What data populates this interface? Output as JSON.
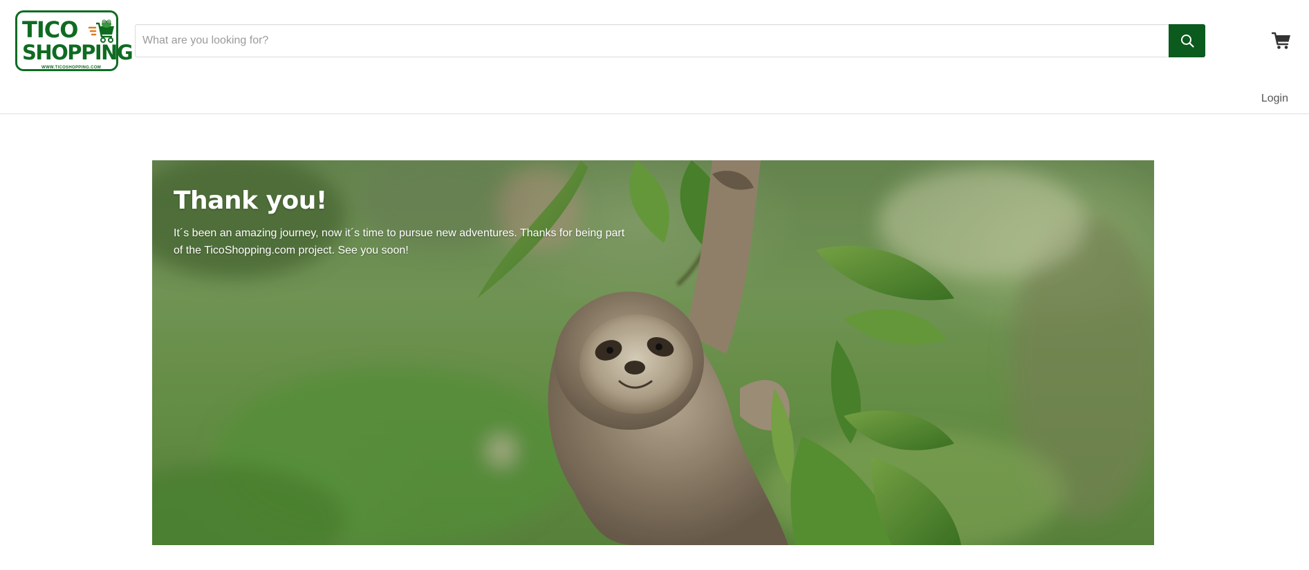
{
  "header": {
    "logo": {
      "line1": "TICO",
      "line2": "SHOPPING",
      "url_text": "WWW.TICOSHOPPING.COM",
      "brand_color": "#0f6b22"
    },
    "search": {
      "placeholder": "What are you looking for?",
      "value": "",
      "button_icon": "search-icon",
      "button_color": "#0b5a1e"
    },
    "cart_icon": "cart-icon",
    "login_label": "Login"
  },
  "hero": {
    "title": "Thank you!",
    "body": "It´s been an amazing journey, now it´s time to pursue new adventures. Thanks for being part of the TicoShopping.com project. See you soon!",
    "image_subject": "sloth hanging from a leafy branch"
  }
}
